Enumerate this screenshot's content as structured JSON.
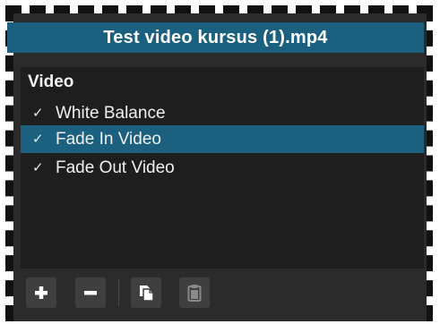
{
  "header": {
    "title": "Test video kursus (1).mp4"
  },
  "filters": {
    "group_label": "Video",
    "items": [
      {
        "label": "White Balance",
        "checked": true,
        "check_glyph": "✓",
        "selected": false
      },
      {
        "label": "Fade In Video",
        "checked": true,
        "check_glyph": "✓",
        "selected": true
      },
      {
        "label": "Fade Out Video",
        "checked": true,
        "check_glyph": "✓",
        "selected": false
      }
    ]
  },
  "toolbar": {
    "buttons": [
      {
        "icon": "plus-icon",
        "enabled": true
      },
      {
        "icon": "minus-icon",
        "enabled": true
      },
      {
        "icon": "copy-icon",
        "enabled": true
      },
      {
        "icon": "paste-icon",
        "enabled": false
      }
    ]
  },
  "colors": {
    "accent": "#1c607f",
    "panel_bg": "#2b2b2b",
    "list_bg": "#1e1e1e",
    "text": "#f0f0f0"
  }
}
